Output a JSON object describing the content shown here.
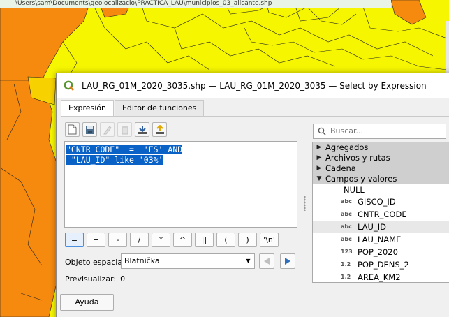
{
  "map": {
    "path_text": "\\Users\\sam\\Documents\\geolocalizacio\\PRÁCTICA_LAU\\municipios_03_alicante.shp"
  },
  "dialog": {
    "title": "LAU_RG_01M_2020_3035.shp — LAU_RG_01M_2020_3035 — Select by Expression",
    "tabs": [
      "Expresión",
      "Editor de funciones"
    ],
    "expression_lines": [
      "\"CNTR_CODE\"  =  'ES' AND",
      " \"LAU_ID\" like '03%'"
    ],
    "operators": [
      "=",
      "+",
      "-",
      "/",
      "*",
      "^",
      "||",
      "(",
      ")",
      "'\\n'"
    ],
    "spatial_object_label": "Objeto espacial",
    "spatial_object_value": "Blatnička",
    "preview_label": "Previsualizar:",
    "preview_value": "0",
    "help_label": "Ayuda",
    "search_placeholder": "Buscar...",
    "groups": [
      {
        "label": "Agregados",
        "expanded": false
      },
      {
        "label": "Archivos y rutas",
        "expanded": false
      },
      {
        "label": "Cadena",
        "expanded": false
      },
      {
        "label": "Campos y valores",
        "expanded": true
      }
    ],
    "null_label": "NULL",
    "fields": [
      {
        "type": "abc",
        "name": "GISCO_ID"
      },
      {
        "type": "abc",
        "name": "CNTR_CODE"
      },
      {
        "type": "abc",
        "name": "LAU_ID"
      },
      {
        "type": "abc",
        "name": "LAU_NAME"
      },
      {
        "type": "123",
        "name": "POP_2020"
      },
      {
        "type": "1.2",
        "name": "POP_DENS_2"
      },
      {
        "type": "1.2",
        "name": "AREA_KM2"
      }
    ]
  },
  "colors": {
    "map_orange": "#f58a0f",
    "map_yellow": "#f6f600",
    "selection": "#0a62c7",
    "group_row": "#cfcfcf"
  }
}
